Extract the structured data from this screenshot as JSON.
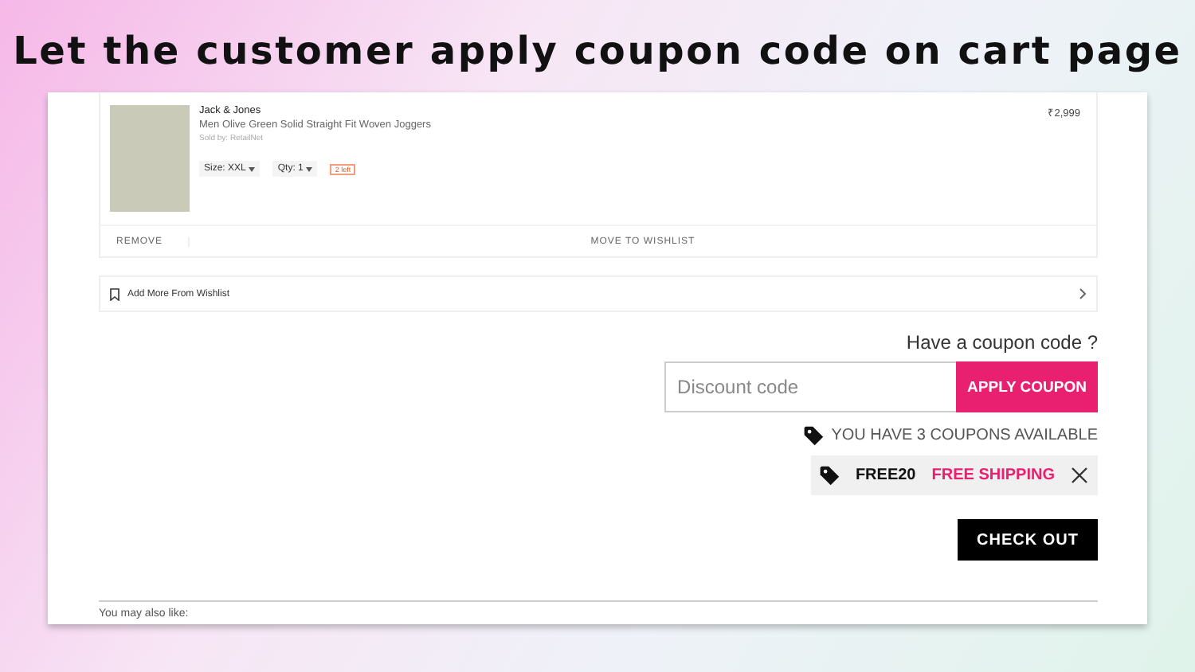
{
  "headline": "Let the customer apply coupon code on cart page",
  "cart_item": {
    "brand": "Jack & Jones",
    "name": "Men Olive Green Solid Straight Fit Woven Joggers",
    "seller": "Sold by: RetailNet",
    "size": "Size: XXL",
    "qty": "Qty: 1",
    "stock": "2 left",
    "price": "₹2,999",
    "actions": [
      "REMOVE",
      "MOVE TO WISHLIST"
    ]
  },
  "wishlist_link": "Add More From Wishlist",
  "coupon": {
    "prompt": "Have a coupon code ?",
    "placeholder": "Discount code",
    "apply_button": "APPLY COUPON",
    "available": "YOU HAVE 3 COUPONS AVAILABLE",
    "applied_code": "FREE20",
    "applied_offer": "FREE SHIPPING"
  },
  "checkout_button": "CHECK OUT",
  "recommendations_title": "You may also like:"
}
